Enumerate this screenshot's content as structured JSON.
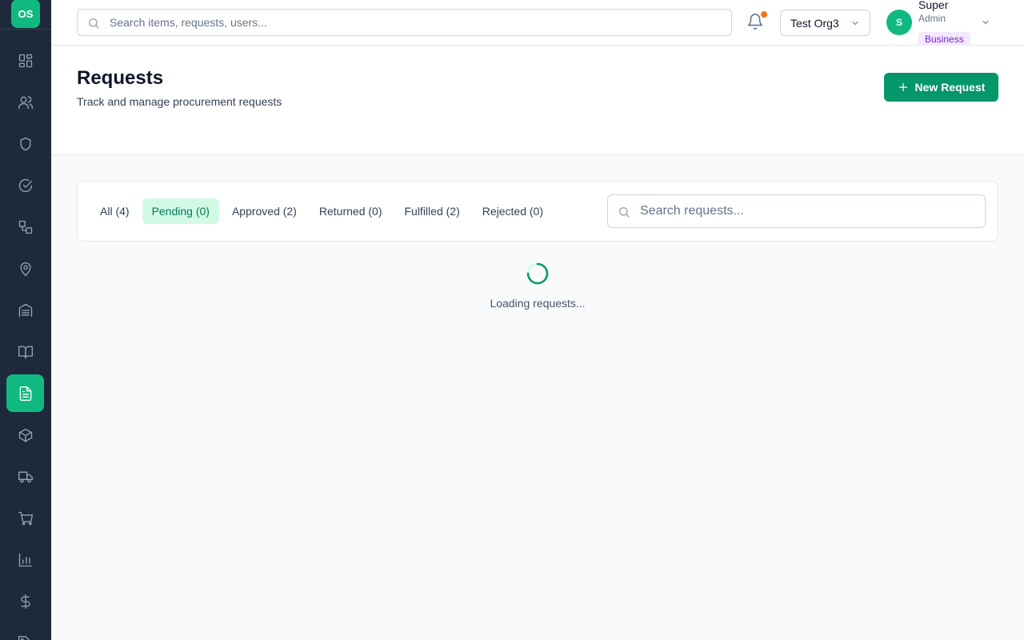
{
  "app": {
    "logo_text": "OS"
  },
  "sidebar": {
    "items": [
      {
        "icon": "dashboard-icon"
      },
      {
        "icon": "users-icon"
      },
      {
        "icon": "shield-icon"
      },
      {
        "icon": "check-circle-icon"
      },
      {
        "icon": "workflow-icon"
      },
      {
        "icon": "map-pin-icon"
      },
      {
        "icon": "building-icon"
      },
      {
        "icon": "book-icon"
      },
      {
        "icon": "file-text-icon",
        "active": true
      },
      {
        "icon": "package-icon"
      },
      {
        "icon": "truck-icon"
      },
      {
        "icon": "shopping-cart-icon"
      },
      {
        "icon": "bar-chart-icon"
      },
      {
        "icon": "dollar-icon"
      },
      {
        "icon": "tag-icon"
      }
    ]
  },
  "topbar": {
    "search_placeholder": "Search items, requests, users...",
    "org_name": "Test Org3",
    "user": {
      "initial": "S",
      "name": "Super",
      "role": "Admin",
      "plan": "Business"
    }
  },
  "page": {
    "title": "Requests",
    "subtitle": "Track and manage procurement requests",
    "new_button_label": "New Request"
  },
  "filters": {
    "tabs": [
      {
        "label": "All (4)",
        "active": false
      },
      {
        "label": "Pending (0)",
        "active": true
      },
      {
        "label": "Approved (2)",
        "active": false
      },
      {
        "label": "Returned (0)",
        "active": false
      },
      {
        "label": "Fulfilled (2)",
        "active": false
      },
      {
        "label": "Rejected (0)",
        "active": false
      }
    ],
    "search_placeholder": "Search requests..."
  },
  "loading": {
    "text": "Loading requests..."
  },
  "colors": {
    "sidebar_bg": "#1e293b",
    "accent": "#10b981",
    "primary_button": "#059669",
    "active_tab_bg": "#d1fae5",
    "active_tab_text": "#047857",
    "notification_dot": "#f97316",
    "plan_badge_bg": "#f3e8ff",
    "plan_badge_text": "#7e22ce"
  }
}
